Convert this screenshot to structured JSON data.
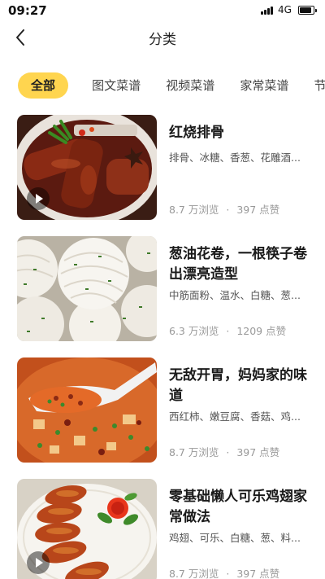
{
  "status_bar": {
    "time": "09:27",
    "network": "4G",
    "battery_level": 0.8
  },
  "nav": {
    "title": "分类"
  },
  "tabs": [
    {
      "label": "全部",
      "active": true
    },
    {
      "label": "图文菜谱",
      "active": false
    },
    {
      "label": "视频菜谱",
      "active": false
    },
    {
      "label": "家常菜谱",
      "active": false
    },
    {
      "label": "节",
      "active": false
    }
  ],
  "recipes": [
    {
      "title": "红烧排骨",
      "ingredients": "排骨、冰糖、香葱、花雕酒...",
      "views": "8.7 万浏览",
      "likes": "397 点赞",
      "has_video": true,
      "image": "braised-pork-ribs"
    },
    {
      "title": "葱油花卷，一根筷子卷出漂亮造型",
      "ingredients": "中筋面粉、温水、白糖、葱...",
      "views": "6.3 万浏览",
      "likes": "1209 点赞",
      "has_video": false,
      "image": "scallion-buns"
    },
    {
      "title": "无敌开胃，妈妈家的味道",
      "ingredients": "西红柿、嫩豆腐、香菇、鸡...",
      "views": "8.7 万浏览",
      "likes": "397 点赞",
      "has_video": false,
      "image": "tomato-tofu-soup"
    },
    {
      "title": "零基础懒人可乐鸡翅家常做法",
      "ingredients": "鸡翅、可乐、白糖、葱、料...",
      "views": "8.7 万浏览",
      "likes": "397 点赞",
      "has_video": true,
      "image": "cola-chicken-wings"
    }
  ],
  "stats_separator": "·",
  "colors": {
    "accent": "#ffd54f",
    "text_primary": "#1a1a1a",
    "text_secondary": "#555555",
    "text_muted": "#999999"
  }
}
